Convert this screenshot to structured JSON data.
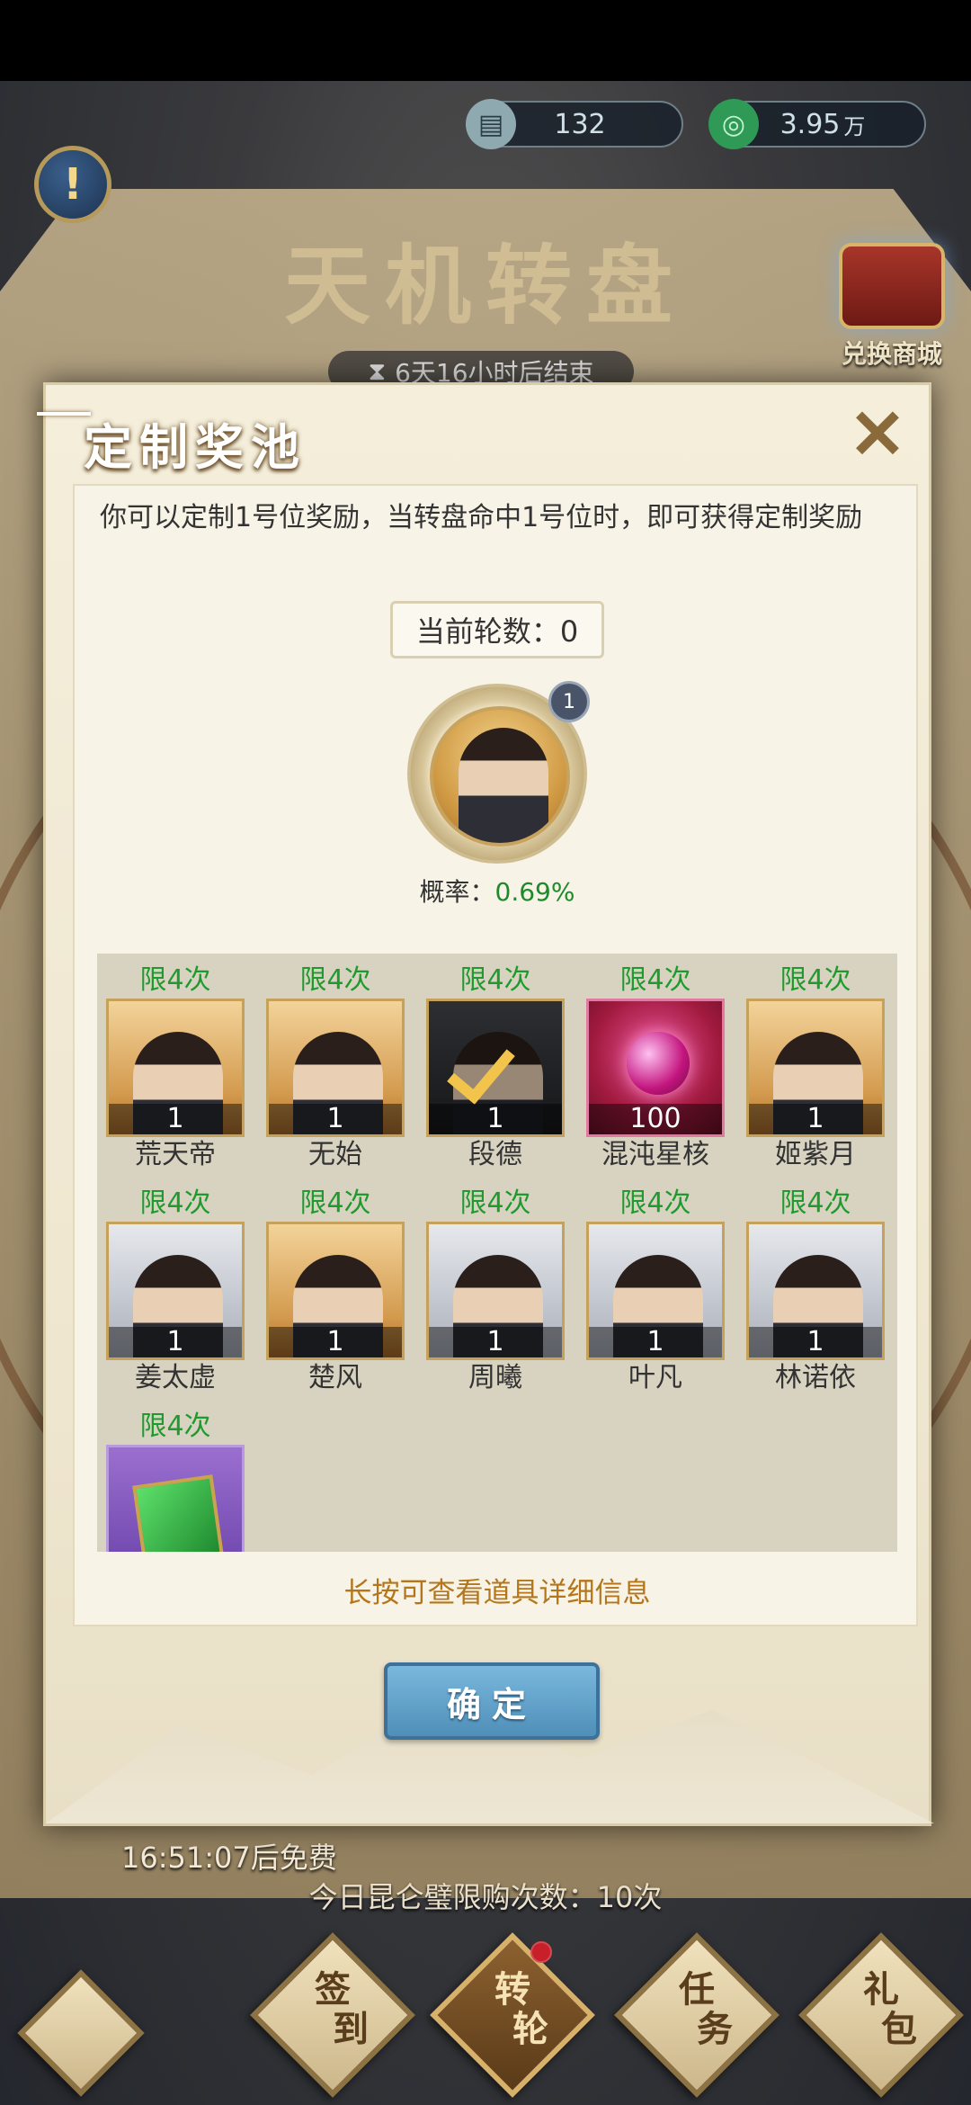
{
  "top_bar": {
    "resource_1": {
      "icon": "scroll-icon",
      "value": "132"
    },
    "resource_2": {
      "icon": "jade-coin-icon",
      "value": "3.95",
      "unit": "万"
    }
  },
  "background": {
    "title": "天机转盘",
    "timer_text": "6天16小时后结束",
    "shop_label": "兑换商城",
    "free_text": "16:51:07后免费",
    "purchase_limit_text": "今日昆仑璧限购次数：10次"
  },
  "bottom_nav": {
    "items": [
      {
        "label_top": "签",
        "label_bottom": "到"
      },
      {
        "label_top": "转",
        "label_bottom": "轮",
        "dot": true
      },
      {
        "label_top": "任",
        "label_bottom": "务"
      },
      {
        "label_top": "礼",
        "label_bottom": "包"
      }
    ]
  },
  "modal": {
    "title": "定制奖池",
    "description": "你可以定制1号位奖励，当转盘命中1号位时，即可获得定制奖励",
    "round_label": "当前轮数：0",
    "slot_badge": "1",
    "probability_label": "概率：",
    "probability_value": "0.69%",
    "hint": "长按可查看道具详细信息",
    "confirm_label": "确定",
    "items": [
      {
        "limit": "限4次",
        "qty": "1",
        "name": "荒天帝",
        "style": "gold"
      },
      {
        "limit": "限4次",
        "qty": "1",
        "name": "无始",
        "style": "gold"
      },
      {
        "limit": "限4次",
        "qty": "1",
        "name": "段德",
        "style": "dark",
        "selected": true
      },
      {
        "limit": "限4次",
        "qty": "100",
        "name": "混沌星核",
        "style": "red"
      },
      {
        "limit": "限4次",
        "qty": "1",
        "name": "姬紫月",
        "style": "gold"
      },
      {
        "limit": "限4次",
        "qty": "1",
        "name": "姜太虚",
        "style": "grey"
      },
      {
        "limit": "限4次",
        "qty": "1",
        "name": "楚风",
        "style": "gold"
      },
      {
        "limit": "限4次",
        "qty": "1",
        "name": "周曦",
        "style": "grey"
      },
      {
        "limit": "限4次",
        "qty": "1",
        "name": "叶凡",
        "style": "grey"
      },
      {
        "limit": "限4次",
        "qty": "1",
        "name": "林诺依",
        "style": "grey"
      },
      {
        "limit": "限4次",
        "qty": "",
        "name": "",
        "style": "purple"
      }
    ]
  }
}
